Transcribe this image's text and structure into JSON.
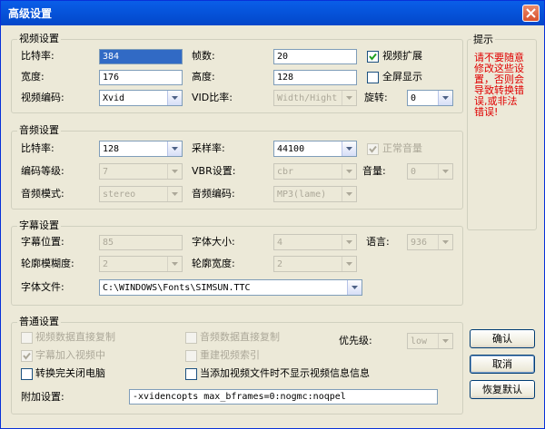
{
  "window": {
    "title": "高级设置"
  },
  "video": {
    "group_title": "视频设置",
    "bitrate_label": "比特率:",
    "bitrate_value": "384",
    "fps_label": "帧数:",
    "fps_value": "20",
    "expand_label": "视频扩展",
    "expand_checked": true,
    "width_label": "宽度:",
    "width_value": "176",
    "height_label": "高度:",
    "height_value": "128",
    "fullscreen_label": "全屏显示",
    "fullscreen_checked": false,
    "codec_label": "视频编码:",
    "codec_value": "Xvid",
    "vid_ratio_label": "VID比率:",
    "vid_ratio_value": "Width/Hight",
    "rotate_label": "旋转:",
    "rotate_value": "0"
  },
  "audio": {
    "group_title": "音频设置",
    "bitrate_label": "比特率:",
    "bitrate_value": "128",
    "samplerate_label": "采样率:",
    "samplerate_value": "44100",
    "normal_volume_label": "正常音量",
    "normal_volume_checked": true,
    "level_label": "编码等级:",
    "level_value": "7",
    "vbr_label": "VBR设置:",
    "vbr_value": "cbr",
    "volume_label": "音量:",
    "volume_value": "0",
    "mode_label": "音频模式:",
    "mode_value": "stereo",
    "codec_label": "音频编码:",
    "codec_value": "MP3(lame)"
  },
  "subtitle": {
    "group_title": "字幕设置",
    "position_label": "字幕位置:",
    "position_value": "85",
    "fontsize_label": "字体大小:",
    "fontsize_value": "4",
    "language_label": "语言:",
    "language_value": "936",
    "blur_label": "轮廓模糊度:",
    "blur_value": "2",
    "outline_label": "轮廓宽度:",
    "outline_value": "2",
    "font_file_label": "字体文件:",
    "font_file_value": "C:\\WINDOWS\\Fonts\\SIMSUN.TTC"
  },
  "general": {
    "group_title": "普通设置",
    "copy_video_label": "视频数据直接复制",
    "copy_audio_label": "音频数据直接复制",
    "priority_label": "优先级:",
    "priority_value": "low",
    "add_subtitle_label": "字幕加入视频中",
    "add_subtitle_checked": true,
    "rebuild_index_label": "重建视频索引",
    "shutdown_label": "转换完关闭电脑",
    "shutdown_checked": false,
    "hide_info_label": "当添加视频文件时不显示视频信息信息",
    "hide_info_checked": false,
    "extra_label": "附加设置:",
    "extra_value": "-xvidencopts max_bframes=0:nogmc:noqpel"
  },
  "hint": {
    "title": "提示",
    "lines": [
      "请不要随意",
      "修改这些设",
      "置，否则会",
      "导致转换错",
      "误,或非法",
      "错误!"
    ]
  },
  "buttons": {
    "ok": "确认",
    "cancel": "取消",
    "restore": "恢复默认"
  },
  "colors": {
    "titlebar": "#0a5ee8",
    "hint_text": "#e00000",
    "selection": "#316ac5"
  }
}
